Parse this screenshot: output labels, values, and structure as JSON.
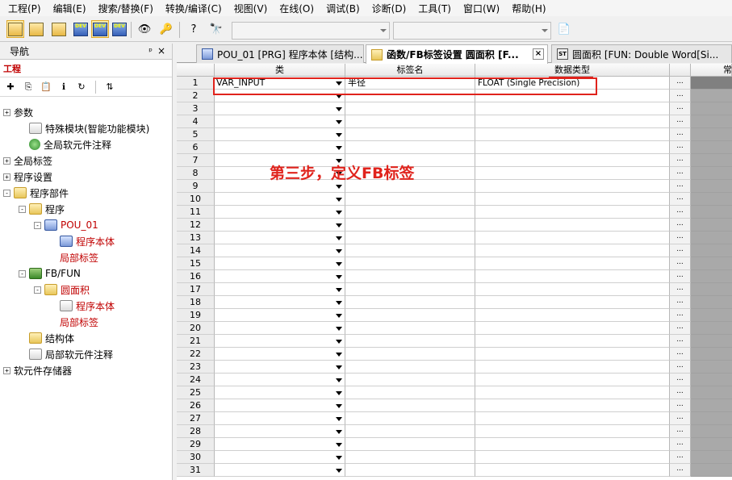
{
  "menu": [
    "工程(P)",
    "编辑(E)",
    "搜索/替换(F)",
    "转换/编译(C)",
    "视图(V)",
    "在线(O)",
    "调试(B)",
    "诊断(D)",
    "工具(T)",
    "窗口(W)",
    "帮助(H)"
  ],
  "toolbar": {
    "dev_label": "DEV"
  },
  "nav": {
    "title": "导航",
    "pin_glyph": "ᵖ",
    "close_glyph": "×",
    "section": "工程",
    "tree": [
      {
        "label": "参数",
        "indent": 0,
        "exp": "+",
        "icon": "grid"
      },
      {
        "label": "特殊模块(智能功能模块)",
        "indent": 1,
        "icon": "doc"
      },
      {
        "label": "全局软元件注释",
        "indent": 1,
        "icon": "globe"
      },
      {
        "label": "全局标签",
        "indent": 0,
        "exp": "+",
        "icon": "grid"
      },
      {
        "label": "程序设置",
        "indent": 0,
        "exp": "+",
        "icon": "grid"
      },
      {
        "label": "程序部件",
        "indent": 0,
        "exp": "-",
        "icon": "folder"
      },
      {
        "label": "程序",
        "indent": 1,
        "exp": "-",
        "icon": "folder"
      },
      {
        "label": "POU_01",
        "indent": 2,
        "exp": "-",
        "icon": "prg",
        "red": true
      },
      {
        "label": "程序本体",
        "indent": 3,
        "icon": "prg",
        "red": true
      },
      {
        "label": "局部标签",
        "indent": 3,
        "icon": "grid",
        "red": true
      },
      {
        "label": "FB/FUN",
        "indent": 1,
        "exp": "-",
        "icon": "chip"
      },
      {
        "label": "圆面积",
        "indent": 2,
        "exp": "-",
        "icon": "folder",
        "red": true
      },
      {
        "label": "程序本体",
        "indent": 3,
        "icon": "doc",
        "red": true
      },
      {
        "label": "局部标签",
        "indent": 3,
        "icon": "grid",
        "red": true
      },
      {
        "label": "结构体",
        "indent": 1,
        "icon": "folder"
      },
      {
        "label": "局部软元件注释",
        "indent": 1,
        "icon": "doc"
      },
      {
        "label": "软元件存储器",
        "indent": 0,
        "exp": "+",
        "icon": "grid"
      }
    ]
  },
  "tabs": [
    {
      "label": "POU_01 [PRG] 程序本体 [结构...",
      "icon": "prg",
      "active": false
    },
    {
      "label": "函数/FB标签设置 圆面积 [F...",
      "icon": "folder",
      "active": true
    },
    {
      "label": "圆面积 [FUN: Double Word[Si...",
      "icon": "st",
      "active": false
    }
  ],
  "tab_close": "×",
  "tab_icon_st": "ST",
  "grid": {
    "headers": {
      "class": "类",
      "label_name": "标签名",
      "data_type": "数据类型",
      "extra": "常"
    },
    "rows_count": 31,
    "btn_label": "...",
    "row1": {
      "num": "1",
      "class": "VAR_INPUT",
      "label_name": "半径",
      "data_type": "FLOAT (Single Precision)"
    }
  },
  "annotation": "第三步，定义FB标签",
  "colors": {
    "highlight": "#e0231c",
    "tree_red": "#c00000",
    "gray_col": "#a9a9a9"
  }
}
